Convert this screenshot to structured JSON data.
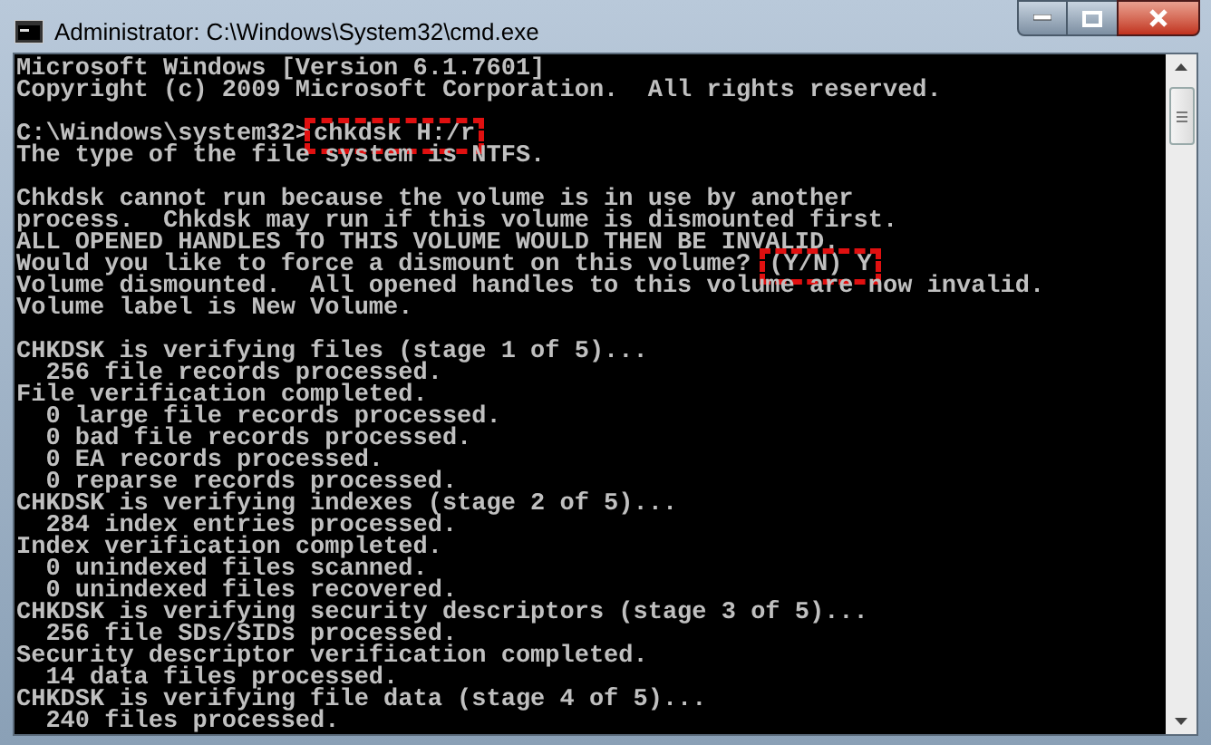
{
  "window": {
    "title": "Administrator: C:\\Windows\\System32\\cmd.exe"
  },
  "console_lines": [
    {
      "kind": "text",
      "text": "Microsoft Windows [Version 6.1.7601]"
    },
    {
      "kind": "text",
      "text": "Copyright (c) 2009 Microsoft Corporation.  All rights reserved."
    },
    {
      "kind": "blank"
    },
    {
      "kind": "text",
      "text": "C:\\Windows\\system32>",
      "highlight": "chkdsk H:/r"
    },
    {
      "kind": "text",
      "text": "The type of the file system is NTFS."
    },
    {
      "kind": "blank"
    },
    {
      "kind": "text",
      "text": "Chkdsk cannot run because the volume is in use by another"
    },
    {
      "kind": "text",
      "text": "process.  Chkdsk may run if this volume is dismounted first."
    },
    {
      "kind": "text",
      "text": "ALL OPENED HANDLES TO THIS VOLUME WOULD THEN BE INVALID."
    },
    {
      "kind": "text",
      "text": "Would you like to force a dismount on this volume? ",
      "highlight": "(Y/N) Y"
    },
    {
      "kind": "text",
      "text": "Volume dismounted.  All opened handles to this volume are now invalid."
    },
    {
      "kind": "text",
      "text": "Volume label is New Volume."
    },
    {
      "kind": "blank"
    },
    {
      "kind": "text",
      "text": "CHKDSK is verifying files (stage 1 of 5)..."
    },
    {
      "kind": "text",
      "text": "  256 file records processed."
    },
    {
      "kind": "text",
      "text": "File verification completed."
    },
    {
      "kind": "text",
      "text": "  0 large file records processed."
    },
    {
      "kind": "text",
      "text": "  0 bad file records processed."
    },
    {
      "kind": "text",
      "text": "  0 EA records processed."
    },
    {
      "kind": "text",
      "text": "  0 reparse records processed."
    },
    {
      "kind": "text",
      "text": "CHKDSK is verifying indexes (stage 2 of 5)..."
    },
    {
      "kind": "text",
      "text": "  284 index entries processed."
    },
    {
      "kind": "text",
      "text": "Index verification completed."
    },
    {
      "kind": "text",
      "text": "  0 unindexed files scanned."
    },
    {
      "kind": "text",
      "text": "  0 unindexed files recovered."
    },
    {
      "kind": "text",
      "text": "CHKDSK is verifying security descriptors (stage 3 of 5)..."
    },
    {
      "kind": "text",
      "text": "  256 file SDs/SIDs processed."
    },
    {
      "kind": "text",
      "text": "Security descriptor verification completed."
    },
    {
      "kind": "text",
      "text": "  14 data files processed."
    },
    {
      "kind": "text",
      "text": "CHKDSK is verifying file data (stage 4 of 5)..."
    },
    {
      "kind": "text",
      "text": "  240 files processed."
    }
  ]
}
